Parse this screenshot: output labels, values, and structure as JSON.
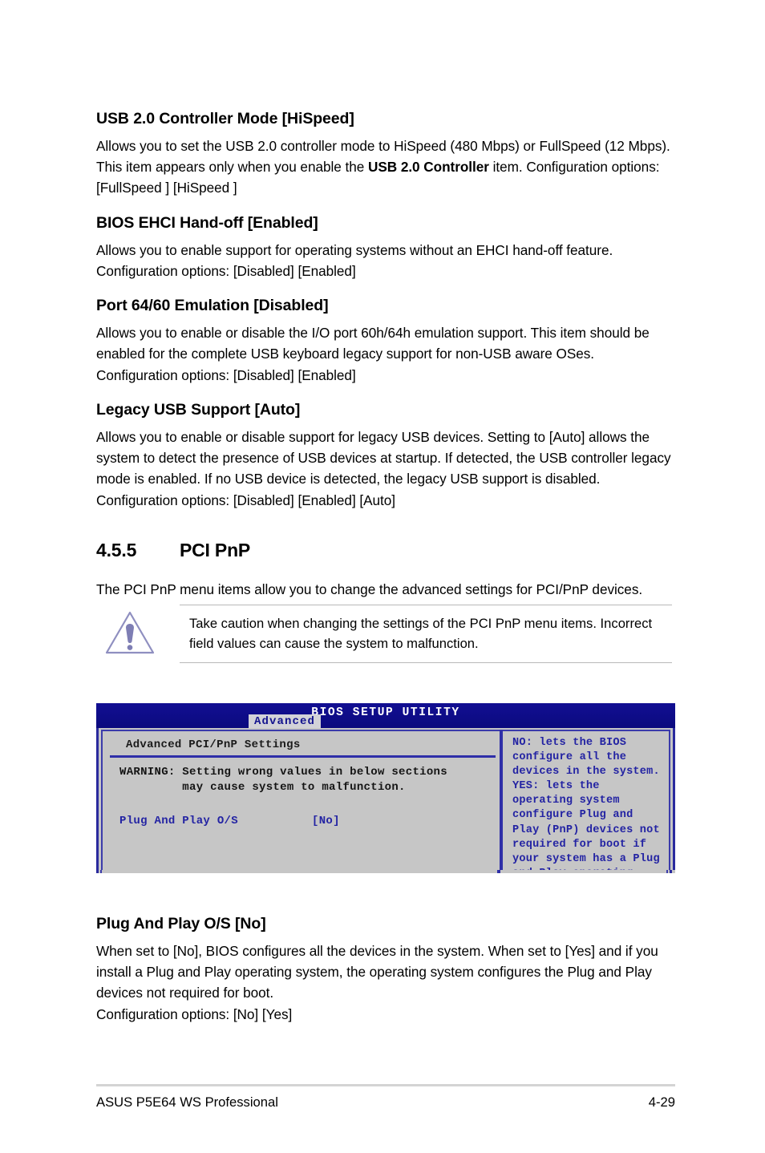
{
  "page": {
    "number": "4-29",
    "footer_left": "ASUS P5E64 WS Professional"
  },
  "items": [
    {
      "heading": "USB 2.0 Controller Mode [HiSpeed]",
      "body_segments": [
        {
          "text": "Allows you to set the USB 2.0 controller mode to HiSpeed (480 Mbps) or FullSpeed (12 Mbps). This item appears only when you enable the ",
          "bold": false
        },
        {
          "text": "USB 2.0 Controller",
          "bold": true
        },
        {
          "text": " item. Configuration options: [FullSpeed ] [HiSpeed ]",
          "bold": false
        }
      ]
    },
    {
      "heading": "BIOS EHCI Hand-off [Enabled]",
      "body_segments": [
        {
          "text": "Allows you to enable support for operating systems without an EHCI hand-off feature. Configuration options: [Disabled] [Enabled]",
          "bold": false
        }
      ]
    },
    {
      "heading": "Port 64/60 Emulation [Disabled]",
      "body_segments": [
        {
          "text": "Allows you to enable or disable the I/O port 60h/64h emulation support. This item should be enabled for the complete USB keyboard legacy support for non-USB aware OSes. Configuration options: [Disabled] [Enabled]",
          "bold": false
        }
      ]
    },
    {
      "heading": "Legacy USB Support [Auto]",
      "body_segments": [
        {
          "text": "Allows you to enable or disable support for legacy USB devices. Setting to [Auto] allows the system to detect the presence of USB devices at startup. If detected, the USB controller legacy mode is enabled. If no USB device is detected, the legacy USB support is disabled. Configuration options: [Disabled] [Enabled] [Auto]",
          "bold": false
        }
      ]
    }
  ],
  "section": {
    "number": "4.5.5",
    "title": "PCI PnP",
    "intro": "The PCI PnP menu items allow you to change the advanced settings for PCI/PnP devices."
  },
  "caution": {
    "icon": "warning-triangle-icon",
    "text": "Take caution when changing the settings of the PCI PnP menu items. Incorrect field values can cause the system to malfunction."
  },
  "bios": {
    "title": "BIOS SETUP UTILITY",
    "active_tab": "Advanced",
    "panel_heading": "Advanced PCI/PnP Settings",
    "warning_line1": "WARNING: Setting wrong values in below sections",
    "warning_line2": "         may cause system to malfunction.",
    "setting_label": "Plug And Play O/S",
    "setting_value": "[No]",
    "help_text": "NO: lets the BIOS configure all the devices in the system. YES: lets the operating system configure Plug and Play (PnP) devices not required for boot if your system has a Plug and Play operating system.",
    "colors": {
      "titlebar": "#0e0e8c",
      "panel_bg": "#c6c6c6",
      "frame": "#2a2a9e",
      "text_blue": "#2323a3",
      "tab_bg": "#d2d2d8"
    }
  },
  "closing": {
    "heading": "Plug And Play O/S [No]",
    "body": "When set to [No], BIOS configures all the devices in the system. When set to [Yes] and if you install a Plug and Play operating system, the operating system configures the Plug and Play devices not required for boot.",
    "options_line": "Configuration options: [No] [Yes]"
  }
}
